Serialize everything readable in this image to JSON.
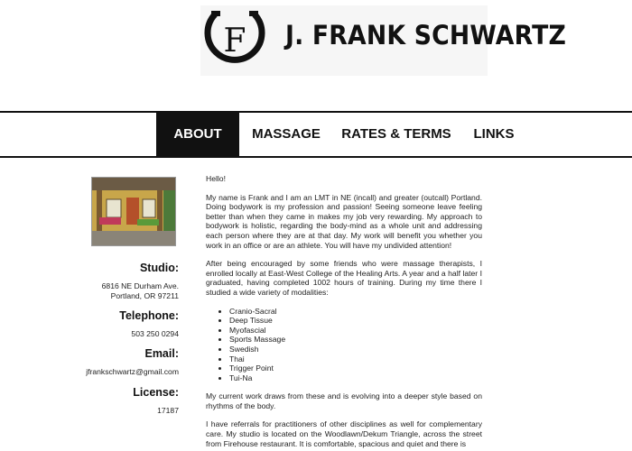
{
  "brand": {
    "logo_letter": "F",
    "name": "J. FRANK SCHWARTZ"
  },
  "nav": {
    "items": [
      {
        "label": "ABOUT",
        "active": true
      },
      {
        "label": "MASSAGE"
      },
      {
        "label": "RATES & TERMS"
      },
      {
        "label": "LINKS"
      }
    ]
  },
  "sidebar": {
    "studio_label": "Studio:",
    "studio_address_line1": "6816 NE Durham Ave.",
    "studio_address_line2": "Portland, OR 97211",
    "telephone_label": "Telephone:",
    "telephone_value": "503 250 0294",
    "email_label": "Email:",
    "email_value": "jfrankschwartz@gmail.com",
    "license_label": "License:",
    "license_value": "17187"
  },
  "main": {
    "greeting": "Hello!",
    "p1": "My name is Frank and I am an LMT in NE (incall) and greater (outcall) Portland. Doing bodywork is my profession and passion! Seeing someone leave feeling better than when they came in makes my job very rewarding. My approach to bodywork is holistic, regarding the body-mind as a whole unit and addressing each person where they are at that day. My work will benefit you whether you work in an office or are an athlete. You will have my undivided attention!",
    "p2": "After being encouraged by some friends who were massage therapists, I enrolled locally at East-West College of the Healing Arts. A year and a half later I graduated, having completed 1002 hours of training. During my time there I studied a wide variety of modalities:",
    "modalities": [
      "Cranio-Sacral",
      "Deep Tissue",
      "Myofascial",
      "Sports Massage",
      "Swedish",
      "Thai",
      "Trigger Point",
      "Tui-Na"
    ],
    "p3": "My current work draws from these and is evolving into a deeper style based on rhythms of the body.",
    "p4": "I have referrals for practitioners of other disciplines as well for complementary care. My studio is located on the Woodlawn/Dekum Triangle, across the street from Firehouse restaurant. It is comfortable, spacious and quiet and there is"
  }
}
